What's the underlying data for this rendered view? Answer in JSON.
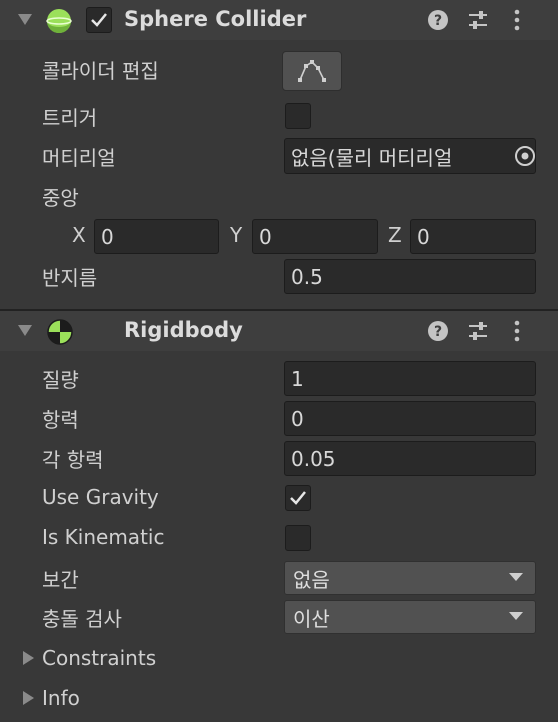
{
  "sphere_collider": {
    "title": "Sphere Collider",
    "edit_collider_label": "콜라이더 편집",
    "trigger_label": "트리거",
    "material_label": "머티리얼",
    "material_value": "없음(물리 머티리얼",
    "center_label": "중앙",
    "center_x_label": "X",
    "center_x": "0",
    "center_y_label": "Y",
    "center_y": "0",
    "center_z_label": "Z",
    "center_z": "0",
    "radius_label": "반지름",
    "radius_value": "0.5",
    "enabled": true,
    "trigger_checked": false
  },
  "rigidbody": {
    "title": "Rigidbody",
    "mass_label": "질량",
    "mass_value": "1",
    "drag_label": "항력",
    "drag_value": "0",
    "angular_drag_label": "각 항력",
    "angular_drag_value": "0.05",
    "use_gravity_label": "Use Gravity",
    "use_gravity_checked": true,
    "is_kinematic_label": "Is Kinematic",
    "is_kinematic_checked": false,
    "interpolate_label": "보간",
    "interpolate_value": "없음",
    "collision_detection_label": "충돌 검사",
    "collision_detection_value": "이산",
    "constraints_label": "Constraints",
    "info_label": "Info"
  },
  "icons": {
    "foldout": "triangle-down-icon",
    "sphere_collider": "sphere-collider-icon",
    "rigidbody": "rigidbody-icon",
    "help": "help-icon",
    "presets": "presets-icon",
    "menu": "kebab-menu-icon",
    "checkmark": "checkmark-icon",
    "object_picker": "object-picker-icon",
    "edit_collider": "edit-collider-icon"
  },
  "colors": {
    "background": "#383838",
    "header": "#3e3e3e",
    "field": "#2a2a2a",
    "collider_green": "#9be05a"
  }
}
